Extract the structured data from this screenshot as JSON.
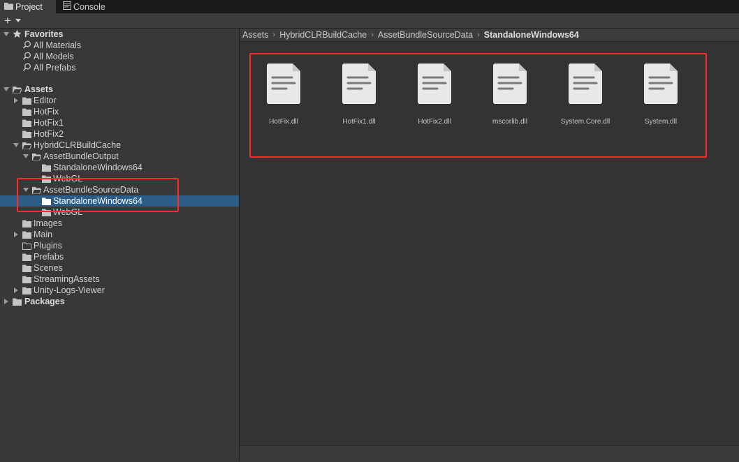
{
  "tabs": [
    {
      "label": "Project",
      "icon": "folder-icon",
      "active": true
    },
    {
      "label": "Console",
      "icon": "console-icon",
      "active": false
    }
  ],
  "toolbar": {
    "create_label": "+"
  },
  "tree": {
    "favorites": {
      "label": "Favorites",
      "items": [
        "All Materials",
        "All Models",
        "All Prefabs"
      ]
    },
    "assets": {
      "label": "Assets",
      "editor": "Editor",
      "hotfix": "HotFix",
      "hotfix1": "HotFix1",
      "hotfix2": "HotFix2",
      "hybrid": "HybridCLRBuildCache",
      "abo": "AssetBundleOutput",
      "abo_sw64": "StandaloneWindows64",
      "abo_webgl": "WebGL",
      "absd": "AssetBundleSourceData",
      "absd_sw64": "StandaloneWindows64",
      "absd_webgl": "WebGL",
      "images": "Images",
      "main": "Main",
      "plugins": "Plugins",
      "prefabs": "Prefabs",
      "scenes": "Scenes",
      "streaming": "StreamingAssets",
      "logs": "Unity-Logs-Viewer"
    },
    "packages": {
      "label": "Packages"
    }
  },
  "breadcrumb": [
    "Assets",
    "HybridCLRBuildCache",
    "AssetBundleSourceData",
    "StandaloneWindows64"
  ],
  "files": [
    "HotFix.dll",
    "HotFix1.dll",
    "HotFix2.dll",
    "mscorlib.dll",
    "System.Core.dll",
    "System.dll"
  ],
  "colors": {
    "selection": "#2c5d87",
    "highlight_box": "#ff2a2a",
    "panel": "#383838",
    "grid_panel": "#333333"
  }
}
